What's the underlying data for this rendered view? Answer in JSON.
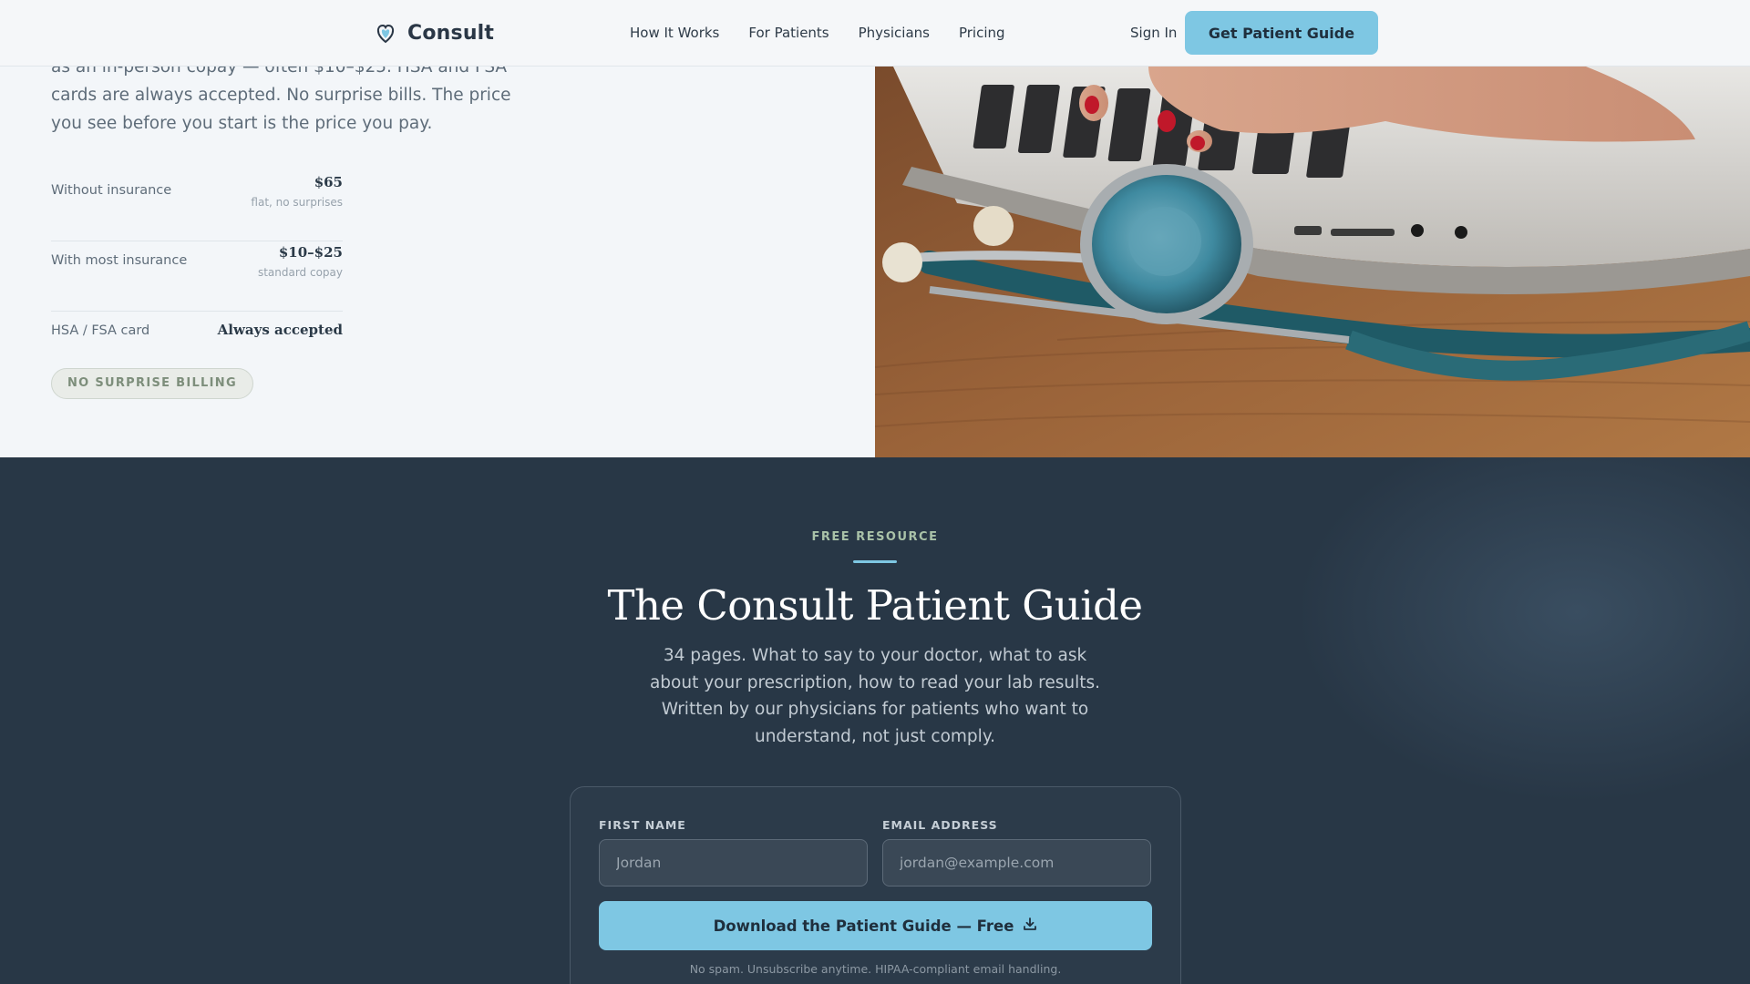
{
  "nav": {
    "brand": "Consult",
    "links": [
      "How It Works",
      "For Patients",
      "Physicians",
      "Pricing"
    ],
    "sign_in": "Sign In",
    "cta": "Get Patient Guide"
  },
  "pricing": {
    "text": "as an in-person copay — often $10–$25. HSA and FSA cards are always accepted. No surprise bills. The price you see before you start is the price you pay.",
    "rows": [
      {
        "label": "Without insurance",
        "value": "$65",
        "note": "flat, no surprises"
      },
      {
        "label": "With most insurance",
        "value": "$10–$25",
        "note": "standard copay"
      },
      {
        "label": "HSA / FSA card",
        "value": "Always accepted"
      }
    ],
    "badge": "NO SURPRISE BILLING"
  },
  "guide": {
    "eyebrow": "FREE RESOURCE",
    "title": "The Consult Patient Guide",
    "description": "34 pages. What to say to your doctor, what to ask about your prescription, how to read your lab results. Written by our physicians for patients who want to understand, not just comply.",
    "form": {
      "first_name_label": "FIRST NAME",
      "first_name_placeholder": "Jordan",
      "email_label": "EMAIL ADDRESS",
      "email_placeholder": "jordan@example.com",
      "submit": "Download the Patient Guide — Free",
      "fineprint": "No spam. Unsubscribe anytime. HIPAA-compliant email handling."
    }
  },
  "colors": {
    "accent": "#7ec7e3",
    "dark_bg": "#283746",
    "light_bg": "#f3f6f9"
  },
  "icons": {
    "brand": "heart-shield-icon",
    "download": "download-icon"
  }
}
